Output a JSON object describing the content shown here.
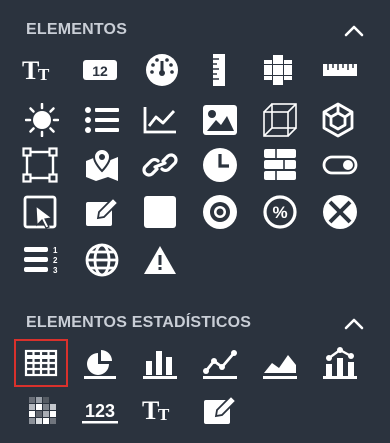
{
  "sections": [
    {
      "title": "ELEMENTOS",
      "toggle_icon": "chevron-up-icon",
      "items": [
        "text-icon",
        "number-badge-icon",
        "gauge-icon",
        "ruler-vertical-icon",
        "cells-icon",
        "ruler-horizontal-icon",
        "sun-icon",
        "list-icon",
        "line-chart-icon",
        "image-icon",
        "cube-wireframe-icon",
        "cube-3d-icon",
        "bounding-box-icon",
        "map-pin-icon",
        "link-icon",
        "clock-icon",
        "database-icon",
        "toggle-icon",
        "cursor-frame-icon",
        "edit-icon",
        "square-icon",
        "camera-icon",
        "percent-icon",
        "close-circle-icon",
        "ordered-list-icon",
        "globe-icon",
        "warning-icon"
      ]
    },
    {
      "title": "ELEMENTOS ESTADÍSTICOS",
      "toggle_icon": "chevron-up-icon",
      "items": [
        "table-icon",
        "pie-chart-icon",
        "bar-chart-icon",
        "line-chart-points-icon",
        "area-chart-icon",
        "bar-line-chart-icon",
        "heatmap-icon",
        "number-text-icon",
        "text-stat-icon",
        "edit-stat-icon"
      ],
      "selected_item": "table-icon"
    }
  ],
  "number_badge_text": "12",
  "number_text": "123",
  "text_glyph": "Tт",
  "colors": {
    "background": "#2b333e",
    "icon": "#ffffff",
    "title": "#c9ced6",
    "selection": "#d9312c"
  }
}
